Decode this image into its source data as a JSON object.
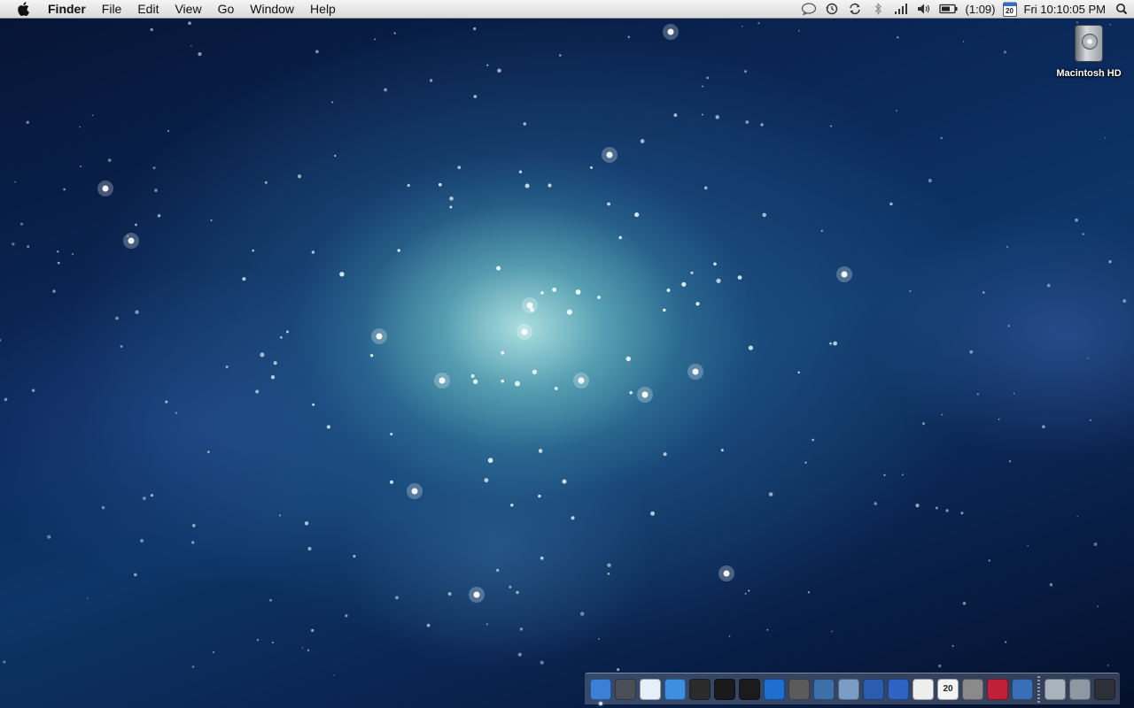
{
  "menubar": {
    "app_name": "Finder",
    "menus": [
      "File",
      "Edit",
      "View",
      "Go",
      "Window",
      "Help"
    ],
    "status": {
      "battery_time": "(1:09)",
      "calendar_day": "20",
      "clock": "Fri 10:10:05 PM"
    },
    "icons": [
      "chat-icon",
      "time-machine-icon",
      "sync-icon",
      "bluetooth-icon",
      "wifi-icon",
      "volume-icon",
      "battery-icon",
      "calendar-icon",
      "spotlight-icon"
    ]
  },
  "desktop": {
    "items": [
      {
        "label": "Macintosh HD",
        "icon": "hard-drive-icon"
      }
    ]
  },
  "dock": {
    "apps": [
      {
        "name": "finder-icon",
        "color": "#3b7fd6",
        "running": true
      },
      {
        "name": "dashboard-icon",
        "color": "#4a4f57",
        "running": false
      },
      {
        "name": "mail-icon",
        "color": "#e6eef7",
        "running": false
      },
      {
        "name": "safari-icon",
        "color": "#3f8fe0",
        "running": false
      },
      {
        "name": "facetime-icon",
        "color": "#2b2b2b",
        "running": false
      },
      {
        "name": "iphone-icon",
        "color": "#1a1a1a",
        "running": false
      },
      {
        "name": "itunes-icon",
        "color": "#1b1b1b",
        "running": false
      },
      {
        "name": "quicktime-icon",
        "color": "#1e6fd0",
        "running": false
      },
      {
        "name": "imovie-icon",
        "color": "#5b5b5b",
        "running": false
      },
      {
        "name": "iphoto-icon",
        "color": "#3d6fa8",
        "running": false
      },
      {
        "name": "preview-icon",
        "color": "#7b9cc4",
        "running": false
      },
      {
        "name": "feather-icon",
        "color": "#2a5db0",
        "running": false
      },
      {
        "name": "word-icon",
        "color": "#2d64c3",
        "running": false
      },
      {
        "name": "textedit-icon",
        "color": "#eeeeee",
        "running": false
      },
      {
        "name": "ical-icon",
        "color": "#f4f4f4",
        "running": false,
        "badge": "20"
      },
      {
        "name": "system-preferences-icon",
        "color": "#8a8a8a",
        "running": false
      },
      {
        "name": "app-store-icon",
        "color": "#c0203a",
        "running": false
      },
      {
        "name": "network-globe-icon",
        "color": "#3a6fb8",
        "running": false
      }
    ],
    "stacks": [
      {
        "name": "documents-stack-icon",
        "color": "#a9b3bd"
      },
      {
        "name": "downloads-stack-icon",
        "color": "#8d98a3"
      },
      {
        "name": "trash-icon",
        "color": "#2c3138"
      }
    ]
  },
  "colors": {
    "menubar_top": "#f5f5f5",
    "menubar_bottom": "#dadada",
    "wallpaper_core": "#bef0eb",
    "wallpaper_edge": "#061434"
  }
}
